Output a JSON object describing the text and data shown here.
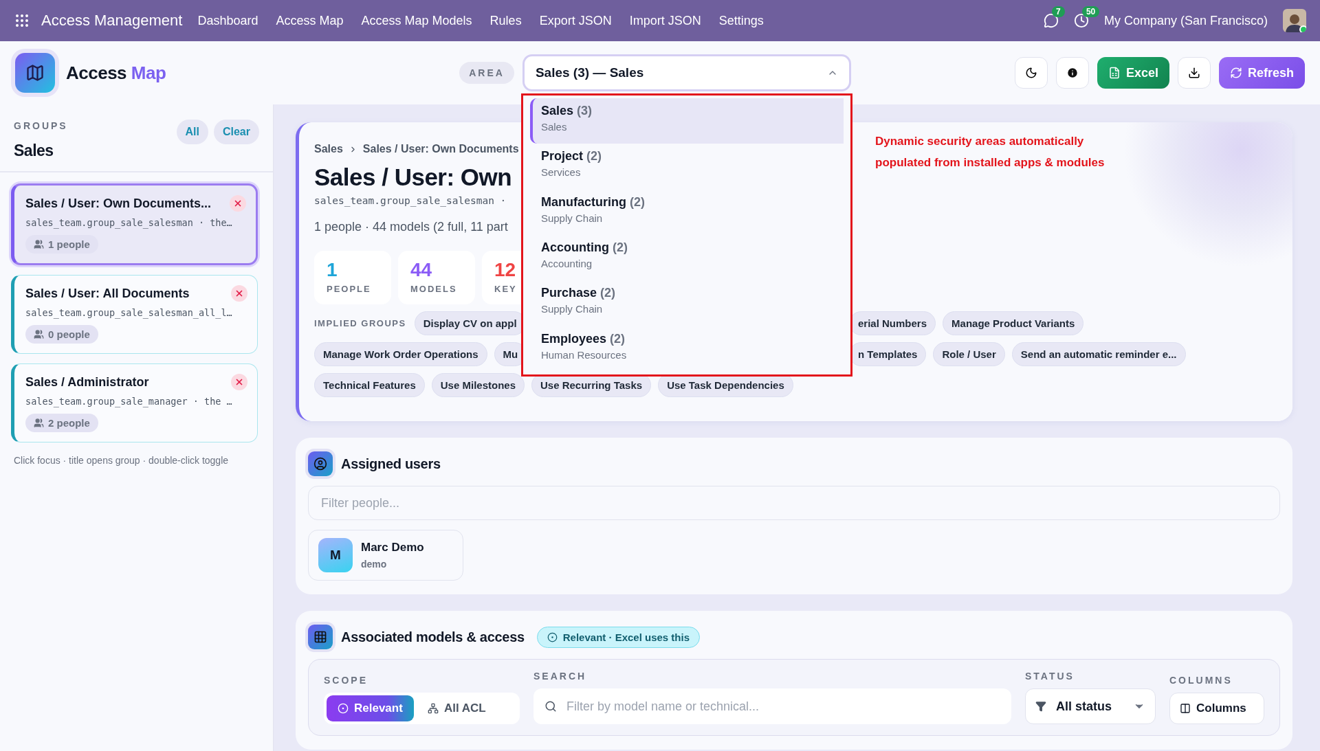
{
  "nav": {
    "app_title": "Access Management",
    "menu": [
      {
        "label": "Dashboard"
      },
      {
        "label": "Access Map"
      },
      {
        "label": "Access Map Models"
      },
      {
        "label": "Rules"
      },
      {
        "label": "Export JSON"
      },
      {
        "label": "Import JSON"
      },
      {
        "label": "Settings"
      }
    ],
    "chat_count": "7",
    "activity_count": "50",
    "company": "My Company (San Francisco)"
  },
  "header": {
    "title": "Access",
    "title_accent": "Map",
    "area_label": "AREA",
    "area_value": "Sales (3) — Sales",
    "area_expanded": true,
    "excel": "Excel",
    "refresh": "Refresh"
  },
  "area_options": [
    {
      "name": "Sales",
      "count": "(3)",
      "category": "Sales",
      "selected": true
    },
    {
      "name": "Project",
      "count": "(2)",
      "category": "Services",
      "selected": false
    },
    {
      "name": "Manufacturing",
      "count": "(2)",
      "category": "Supply Chain",
      "selected": false
    },
    {
      "name": "Accounting",
      "count": "(2)",
      "category": "Accounting",
      "selected": false
    },
    {
      "name": "Purchase",
      "count": "(2)",
      "category": "Supply Chain",
      "selected": false
    },
    {
      "name": "Employees",
      "count": "(2)",
      "category": "Human Resources",
      "selected": false
    }
  ],
  "sidebar": {
    "heading": "GROUPS",
    "title": "Sales",
    "all": "All",
    "clear": "Clear",
    "groups": [
      {
        "name": "Sales / User: Own Documents...",
        "technical": "sales_team.group_sale_salesman · the…",
        "people": "1 people",
        "selected": true
      },
      {
        "name": "Sales / User: All Documents",
        "technical": "sales_team.group_sale_salesman_all_l…",
        "people": "0 people",
        "selected": false
      },
      {
        "name": "Sales / Administrator",
        "technical": "sales_team.group_sale_manager · the …",
        "people": "2 people",
        "selected": false
      }
    ],
    "hint": "Click focus · title opens group · double-click toggle"
  },
  "detail": {
    "breadcrumb": [
      "Sales",
      "Sales / User: Own Documents"
    ],
    "title": "Sales / User: Own",
    "technical": "sales_team.group_sale_salesman ·",
    "summary": "1 people · 44 models (2 full, 11 part",
    "stats": [
      {
        "value": "1",
        "label": "PEOPLE",
        "color": "#1ea5d8"
      },
      {
        "value": "44",
        "label": "MODELS",
        "color": "#8b5cf6"
      },
      {
        "value": "12",
        "label": "KEY",
        "color": "#ef4444"
      }
    ],
    "implied_label": "IMPLIED GROUPS",
    "chip_rows": [
      {
        "left": [
          "Display CV on appl"
        ],
        "right": [
          "erial Numbers",
          "Manage Product Variants"
        ]
      },
      {
        "left": [
          "Manage Work Order Operations",
          "Mu"
        ],
        "right": [
          "n Templates",
          "Role / User",
          "Send an automatic reminder e..."
        ]
      }
    ],
    "chips_last": [
      "Technical Features",
      "Use Milestones",
      "Use Recurring Tasks",
      "Use Task Dependencies"
    ],
    "annotation": "Dynamic security areas automatically populated from installed apps & modules"
  },
  "assigned": {
    "title": "Assigned users",
    "filter_placeholder": "Filter people...",
    "users": [
      {
        "initial": "M",
        "name": "Marc Demo",
        "login": "demo"
      }
    ]
  },
  "models": {
    "title": "Associated models & access",
    "badge": "Relevant · Excel uses this",
    "scope_label": "SCOPE",
    "scopes": [
      {
        "label": "Relevant",
        "selected": true
      },
      {
        "label": "All ACL",
        "selected": false
      }
    ],
    "search_label": "SEARCH",
    "search_placeholder": "Filter by model name or technical...",
    "status_label": "STATUS",
    "status_value": "All status",
    "columns_label": "COLUMNS",
    "columns_button": "Columns"
  }
}
